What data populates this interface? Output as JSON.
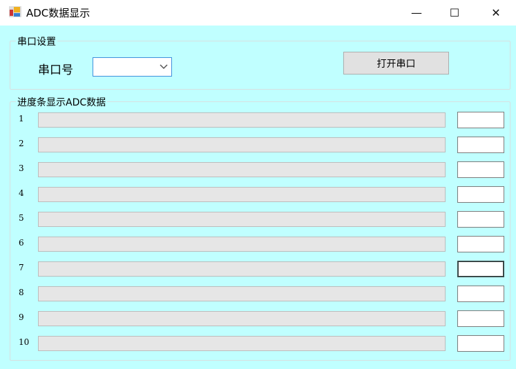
{
  "window": {
    "title": "ADC数据显示",
    "minimize": "—",
    "maximize": "☐",
    "close": "✕"
  },
  "serial": {
    "group_label": "串口设置",
    "port_label": "串口号",
    "port_value": "",
    "open_button": "打开串口"
  },
  "progress": {
    "group_label": "进度条显示ADC数据",
    "rows": [
      {
        "label": "1",
        "value": 0,
        "text": ""
      },
      {
        "label": "2",
        "value": 0,
        "text": ""
      },
      {
        "label": "3",
        "value": 0,
        "text": ""
      },
      {
        "label": "4",
        "value": 0,
        "text": ""
      },
      {
        "label": "5",
        "value": 0,
        "text": ""
      },
      {
        "label": "6",
        "value": 0,
        "text": ""
      },
      {
        "label": "7",
        "value": 0,
        "text": ""
      },
      {
        "label": "8",
        "value": 0,
        "text": ""
      },
      {
        "label": "9",
        "value": 0,
        "text": ""
      },
      {
        "label": "10",
        "value": 0,
        "text": ""
      }
    ]
  }
}
